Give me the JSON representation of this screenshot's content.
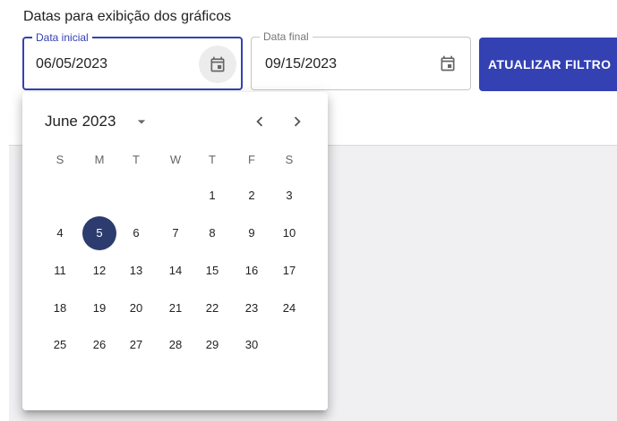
{
  "filter": {
    "heading": "Datas para exibição dos gráficos",
    "start": {
      "label": "Data inicial",
      "value": "06/05/2023",
      "icon": "calendar-icon"
    },
    "end": {
      "label": "Data final",
      "value": "09/15/2023",
      "icon": "calendar-icon"
    },
    "apply_label": "ATUALIZAR FILTRO"
  },
  "calendar": {
    "month_label": "June 2023",
    "weekdays": [
      "S",
      "M",
      "T",
      "W",
      "T",
      "F",
      "S"
    ],
    "first_weekday_index": 4,
    "days": [
      "1",
      "2",
      "3",
      "4",
      "5",
      "6",
      "7",
      "8",
      "9",
      "10",
      "11",
      "12",
      "13",
      "14",
      "15",
      "16",
      "17",
      "18",
      "19",
      "20",
      "21",
      "22",
      "23",
      "24",
      "25",
      "26",
      "27",
      "28",
      "29",
      "30"
    ],
    "selected_day": "5",
    "icons": {
      "dropdown": "chevron-down-icon",
      "prev": "chevron-left-icon",
      "next": "chevron-right-icon"
    }
  },
  "colors": {
    "accent": "#3441b3",
    "selected_day": "#2c3c6e",
    "content_background": "#f0f0f2"
  }
}
